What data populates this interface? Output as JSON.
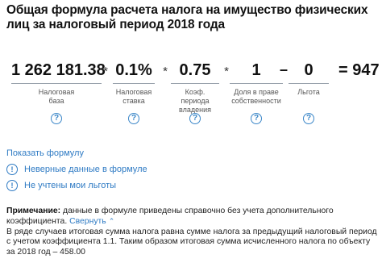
{
  "title": "Общая формула расчета налога на имущество физических лиц за налоговый период 2018 года",
  "formula": {
    "terms": [
      {
        "value": "1 262 181.38",
        "label": "Налоговая база",
        "label_lines": [
          "Налоговая",
          "база"
        ]
      },
      {
        "value": "0.1%",
        "label": "Налоговая ставка",
        "label_lines": [
          "Налоговая",
          "ставка"
        ]
      },
      {
        "value": "0.75",
        "label": "Коэф. периода владения",
        "label_lines": [
          "Коэф. периода",
          "владения"
        ]
      },
      {
        "value": "1",
        "label": "Доля в праве собственности",
        "label_lines": [
          "Доля в праве",
          "собственности"
        ]
      },
      {
        "value": "0",
        "label": "Льгота",
        "label_lines": [
          "Льгота"
        ]
      }
    ],
    "operators": [
      "*",
      "*",
      "*",
      "–"
    ],
    "result": "= 947",
    "help_icon": "?"
  },
  "show_formula_link": "Показать формулу",
  "warnings": [
    {
      "icon": "exclamation-circle-icon",
      "text": "Неверные данные в формуле"
    },
    {
      "icon": "exclamation-circle-icon",
      "text": "Не учтены мои льготы"
    }
  ],
  "note": {
    "label": "Примечание:",
    "text1": " данные в формуле приведены справочно без учета дополнительного коэффициента.",
    "collapse_link": "Свернуть",
    "text2": "В ряде случаев итоговая сумма налога равна сумме налога за предыдущий налоговый период с учетом коэффициента 1.1. Таким образом итоговая сумма исчисленного налога по объекту за 2018 год – 458.00"
  },
  "colors": {
    "link": "#2f7bc4",
    "text": "#111111",
    "muted": "#555555"
  }
}
